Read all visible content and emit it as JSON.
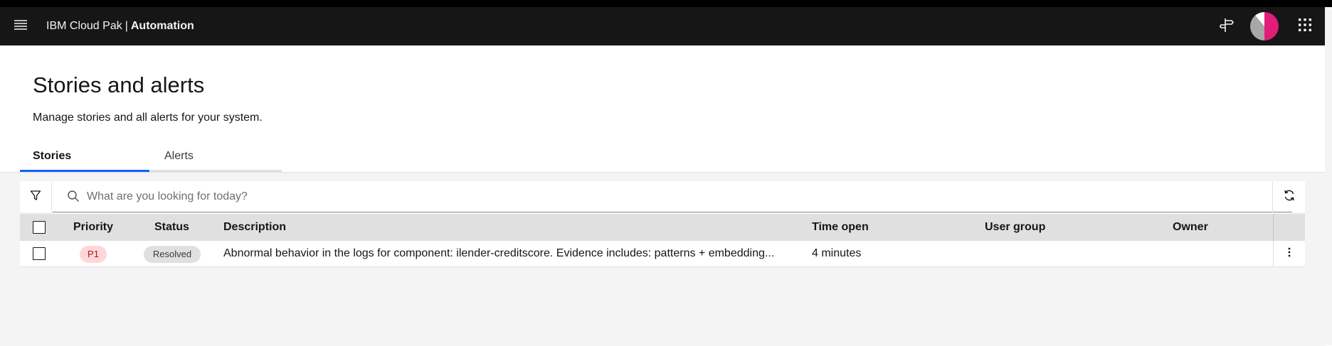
{
  "header": {
    "brand_prefix": "IBM Cloud Pak",
    "brand_separator": "|",
    "brand_product": "Automation",
    "icons": [
      "menu-icon",
      "signpost-icon",
      "avatar",
      "app-switcher-icon"
    ]
  },
  "page": {
    "title": "Stories and alerts",
    "subtitle": "Manage stories and all alerts for your system."
  },
  "tabs": [
    {
      "label": "Stories",
      "selected": true
    },
    {
      "label": "Alerts",
      "selected": false
    }
  ],
  "search": {
    "placeholder": "What are you looking for today?",
    "value": ""
  },
  "table": {
    "columns": [
      "Priority",
      "Status",
      "Description",
      "Time open",
      "User group",
      "Owner"
    ],
    "rows": [
      {
        "priority": "P1",
        "status": "Resolved",
        "description": "Abnormal behavior in the logs for component: ilender-creditscore. Evidence includes: patterns + embedding...",
        "time_open": "4 minutes",
        "user_group": "",
        "owner": ""
      }
    ]
  },
  "colors": {
    "header_bg": "#161616",
    "accent": "#0f62fe",
    "priority_tag_bg": "#ffd7d9",
    "priority_tag_text": "#a2191f",
    "status_tag_bg": "#e0e0e0",
    "avatar_primary": "#e01e79"
  }
}
